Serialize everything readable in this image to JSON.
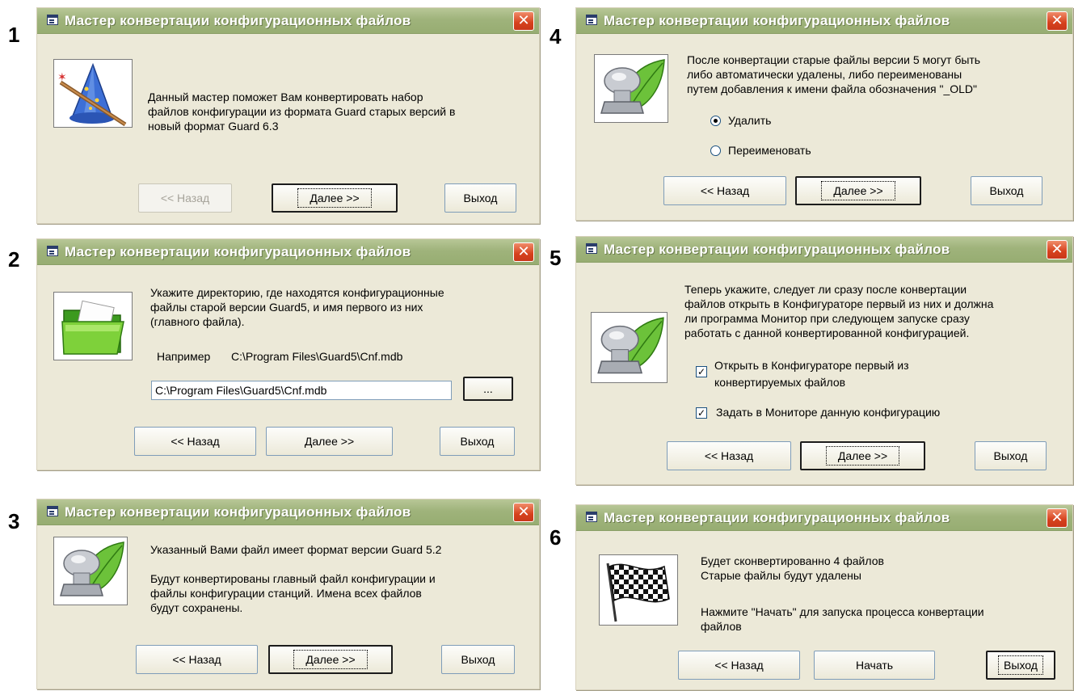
{
  "title": "Мастер конвертации конфигурационных файлов",
  "close_glyph": "✕",
  "step_numbers": [
    "1",
    "2",
    "3",
    "4",
    "5",
    "6"
  ],
  "buttons": {
    "back": "<< Назад",
    "next": "Далее >>",
    "exit": "Выход",
    "start": "Начать",
    "browse": "..."
  },
  "dialog1": {
    "icon": "wizard-hat-icon",
    "message": [
      "Данный мастер поможет Вам конвертировать набор",
      "файлов конфигурации из формата Guard старых версий в",
      "новый формат Guard 6.3"
    ],
    "back_disabled": true
  },
  "dialog2": {
    "icon": "folder-icon",
    "message": [
      "Укажите директорию, где находятся конфигурационные",
      "файлы старой версии Guard5, и имя первого из них",
      "(главного файла)."
    ],
    "example_label": "Например",
    "example_path": "C:\\Program Files\\Guard5\\Cnf.mdb",
    "path_value": "C:\\Program Files\\Guard5\\Cnf.mdb"
  },
  "dialog3": {
    "icon": "bolt-leaf-icon",
    "message1": "Указанный Вами файл имеет формат версии Guard 5.2",
    "message2": [
      "Будут конвертированы главный файл конфигурации и",
      "файлы  конфигурации станций. Имена всех файлов",
      "будут   сохранены."
    ]
  },
  "dialog4": {
    "icon": "bolt-leaf-icon",
    "message": [
      "После конвертации старые файлы версии 5 могут быть",
      "либо автоматически удалены, либо переименованы",
      "путем добавления к имени файла обозначения \"_OLD\""
    ],
    "option_delete": "Удалить",
    "option_rename": "Переименовать",
    "selected": "Удалить"
  },
  "dialog5": {
    "icon": "bolt-leaf-icon",
    "message": [
      "Теперь укажите, следует ли сразу после конвертации",
      "файлов открыть в Конфигураторе первый из них и должна",
      "ли программа Монитор при следующем запуске сразу",
      "работать с данной конвертированной конфигурацией."
    ],
    "check1": [
      "Открыть в Конфигураторе первый из",
      "конвертируемых   файлов"
    ],
    "check2": "Задать в Мониторе данную конфигурацию",
    "check1_checked": true,
    "check2_checked": true,
    "check_glyph": "✓"
  },
  "dialog6": {
    "icon": "checkered-flag-icon",
    "message1": [
      "Будет сконвертированно 4 файлов",
      "Старые файлы будут удалены"
    ],
    "message2": [
      "Нажмите \"Начать\" для запуска процесса конвертации",
      "файлов"
    ]
  }
}
